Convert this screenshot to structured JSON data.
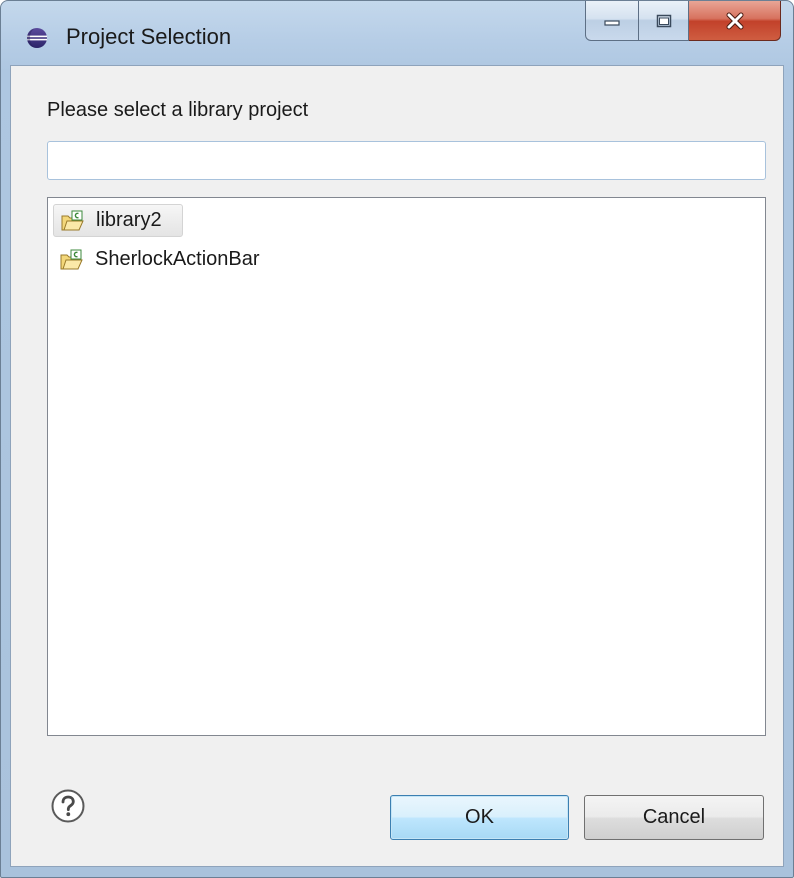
{
  "window": {
    "title": "Project Selection",
    "accent_color": "#3c7fb1",
    "close_color": "#c2412a"
  },
  "dialog": {
    "prompt": "Please select a library project",
    "filter": {
      "value": "",
      "placeholder": ""
    },
    "projects": [
      {
        "label": "library2",
        "selected": true,
        "icon": "project-folder-icon"
      },
      {
        "label": "SherlockActionBar",
        "selected": false,
        "icon": "project-folder-icon"
      }
    ]
  },
  "buttons": {
    "ok_label": "OK",
    "cancel_label": "Cancel",
    "help_icon": "help-icon"
  }
}
